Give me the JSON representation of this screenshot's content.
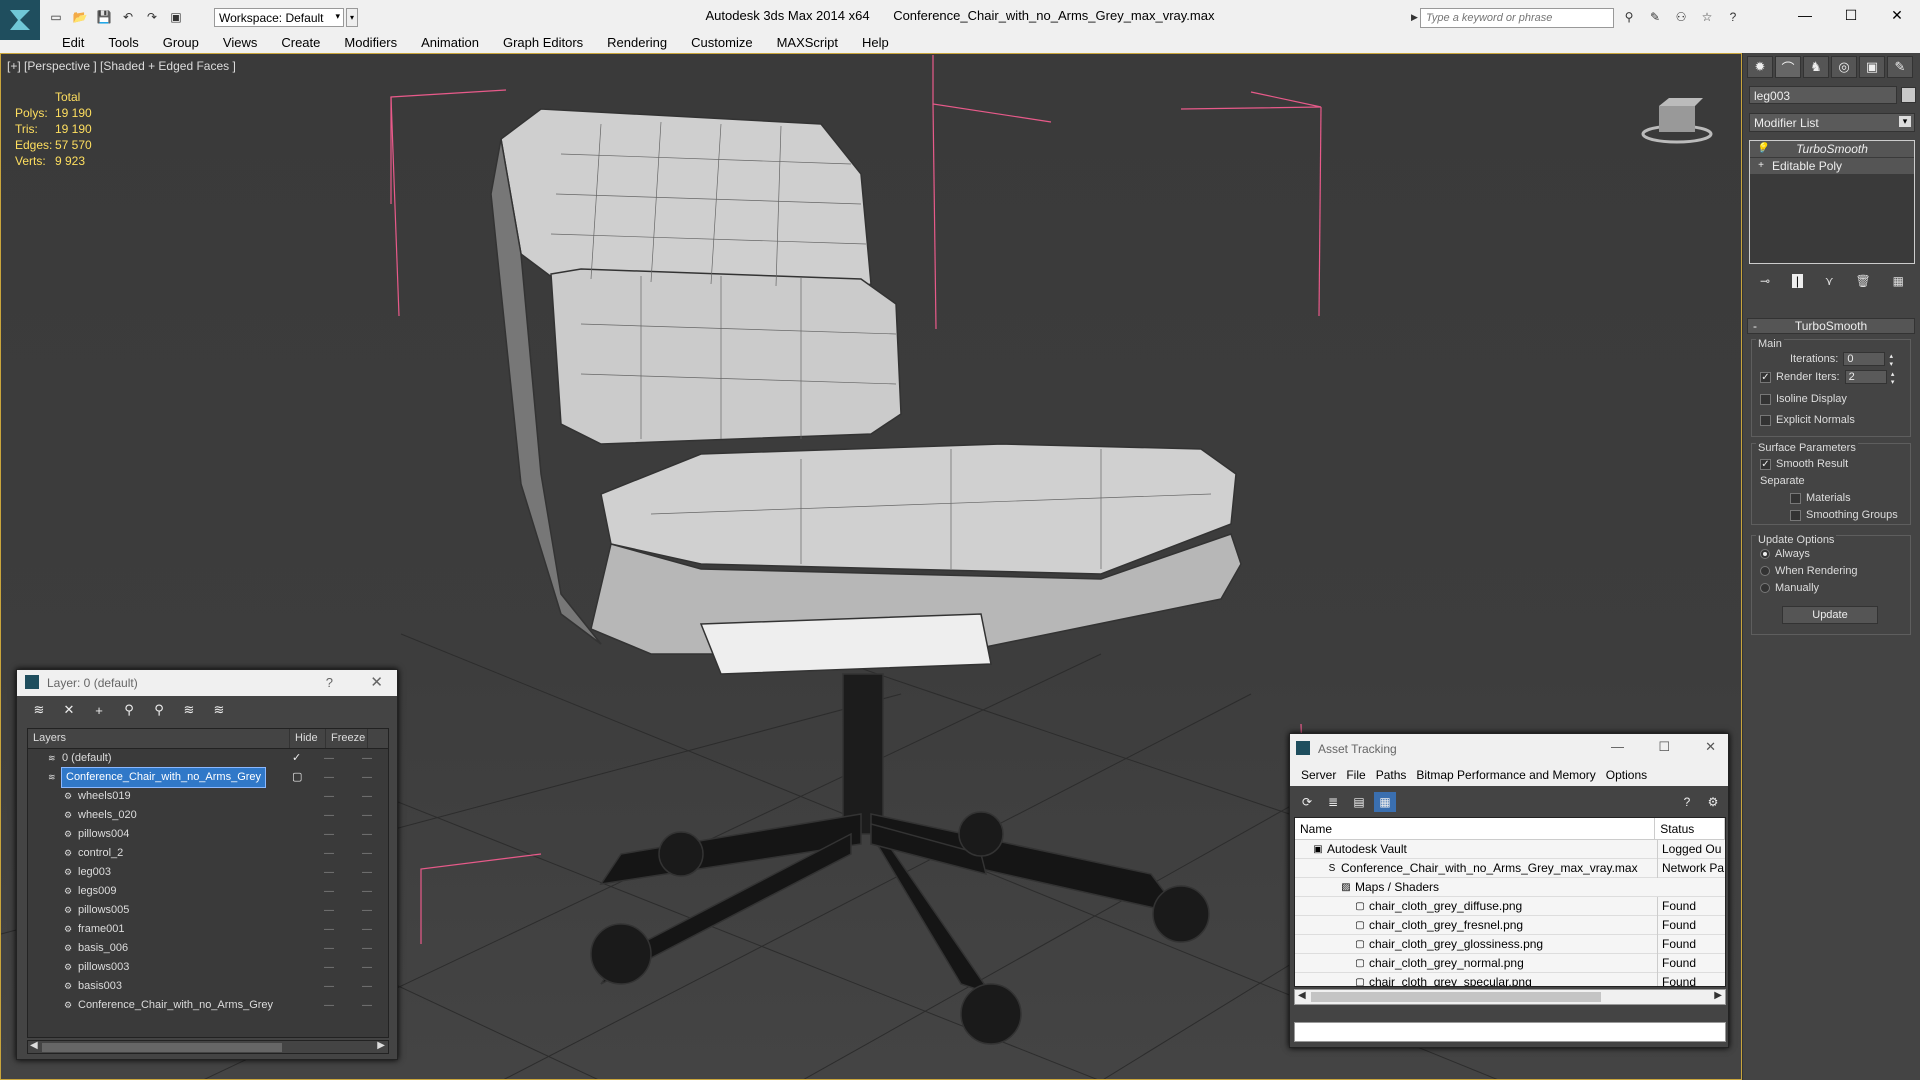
{
  "app": {
    "name": "Autodesk 3ds Max  2014 x64",
    "file": "Conference_Chair_with_no_Arms_Grey_max_vray.max",
    "workspace": "Workspace: Default",
    "search_placeholder": "Type a keyword or phrase"
  },
  "menu": [
    "Edit",
    "Tools",
    "Group",
    "Views",
    "Create",
    "Modifiers",
    "Animation",
    "Graph Editors",
    "Rendering",
    "Customize",
    "MAXScript",
    "Help"
  ],
  "viewport": {
    "label": "[+] [Perspective ] [Shaded + Edged Faces ]",
    "stats": {
      "header": "Total",
      "rows": [
        {
          "k": "Polys:",
          "v": "19 190"
        },
        {
          "k": "Tris:",
          "v": "19 190"
        },
        {
          "k": "Edges:",
          "v": "57 570"
        },
        {
          "k": "Verts:",
          "v": "9 923"
        }
      ]
    }
  },
  "command_panel": {
    "object_name": "leg003",
    "modifier_list": "Modifier List",
    "stack": [
      "TurboSmooth",
      "Editable Poly"
    ],
    "rollout": "TurboSmooth",
    "main_label": "Main",
    "iterations_label": "Iterations:",
    "iterations_value": "0",
    "render_iters_label": "Render Iters:",
    "render_iters_value": "2",
    "isoline": "Isoline Display",
    "explicit_normals": "Explicit Normals",
    "surface_params": "Surface Parameters",
    "smooth_result": "Smooth Result",
    "separate": "Separate",
    "materials": "Materials",
    "smoothing_groups": "Smoothing Groups",
    "update_options": "Update Options",
    "always": "Always",
    "when_rendering": "When Rendering",
    "manually": "Manually",
    "update_btn": "Update"
  },
  "layer_dialog": {
    "title": "Layer: 0 (default)",
    "help": "?",
    "columns": [
      "Layers",
      "Hide",
      "Freeze"
    ],
    "rows": [
      {
        "name": "0 (default)",
        "level": 0
      },
      {
        "name": "Conference_Chair_with_no_Arms_Grey",
        "level": 0
      },
      {
        "name": "wheels019",
        "level": 1
      },
      {
        "name": "wheels_020",
        "level": 1
      },
      {
        "name": "pillows004",
        "level": 1
      },
      {
        "name": "control_2",
        "level": 1
      },
      {
        "name": "leg003",
        "level": 1
      },
      {
        "name": "legs009",
        "level": 1
      },
      {
        "name": "pillows005",
        "level": 1
      },
      {
        "name": "frame001",
        "level": 1
      },
      {
        "name": "basis_006",
        "level": 1
      },
      {
        "name": "pillows003",
        "level": 1
      },
      {
        "name": "basis003",
        "level": 1
      },
      {
        "name": "Conference_Chair_with_no_Arms_Grey",
        "level": 1
      }
    ]
  },
  "asset_dialog": {
    "title": "Asset Tracking",
    "menu": [
      "Server",
      "File",
      "Paths",
      "Bitmap Performance and Memory",
      "Options"
    ],
    "columns": [
      "Name",
      "Status"
    ],
    "rows": [
      {
        "name": "Autodesk Vault",
        "status": "Logged Ou",
        "level": 0
      },
      {
        "name": "Conference_Chair_with_no_Arms_Grey_max_vray.max",
        "status": "Network Pa",
        "level": 1
      },
      {
        "name": "Maps / Shaders",
        "status": "",
        "level": 2
      },
      {
        "name": "chair_cloth_grey_diffuse.png",
        "status": "Found",
        "level": 3
      },
      {
        "name": "chair_cloth_grey_fresnel.png",
        "status": "Found",
        "level": 3
      },
      {
        "name": "chair_cloth_grey_glossiness.png",
        "status": "Found",
        "level": 3
      },
      {
        "name": "chair_cloth_grey_normal.png",
        "status": "Found",
        "level": 3
      },
      {
        "name": "chair_cloth_grey_specular.png",
        "status": "Found",
        "level": 3
      }
    ]
  },
  "colors": {
    "stats_text": "#ffdf5f",
    "selection": "#3078c8",
    "viewport_border": "#c9a53c",
    "bounding_box": "#e85a8a"
  }
}
